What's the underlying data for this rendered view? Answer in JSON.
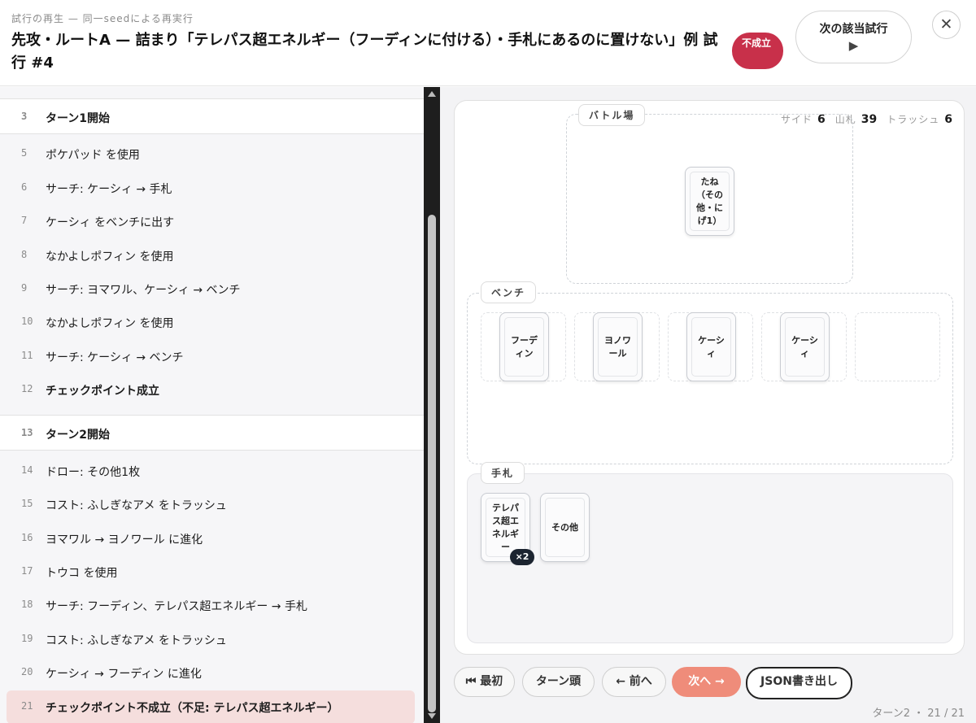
{
  "header": {
    "subtitle": "試行の再生 — 同一seedによる再実行",
    "title": "先攻・ルートA — 詰まり「テレパス超エネルギー（フーディンに付ける）・手札にあるのに置けない」例 試行 #4",
    "badge": "不成立",
    "next_trial_label": "次の該当試行",
    "next_trial_icon": "play-icon",
    "close_icon": "close-icon"
  },
  "log": [
    {
      "num": "3",
      "text": "ターン1開始",
      "kind": "turn"
    },
    {
      "num": "5",
      "text": "ポケパッド を使用",
      "kind": "normal"
    },
    {
      "num": "6",
      "text": "サーチ: ケーシィ → 手札",
      "kind": "normal"
    },
    {
      "num": "7",
      "text": "ケーシィ をベンチに出す",
      "kind": "normal"
    },
    {
      "num": "8",
      "text": "なかよしポフィン を使用",
      "kind": "normal"
    },
    {
      "num": "9",
      "text": "サーチ: ヨマワル、ケーシィ → ベンチ",
      "kind": "normal"
    },
    {
      "num": "10",
      "text": "なかよしポフィン を使用",
      "kind": "normal"
    },
    {
      "num": "11",
      "text": "サーチ: ケーシィ → ベンチ",
      "kind": "normal"
    },
    {
      "num": "12",
      "text": "チェックポイント成立",
      "kind": "bold"
    },
    {
      "num": "13",
      "text": "ターン2開始",
      "kind": "turn"
    },
    {
      "num": "14",
      "text": "ドロー: その他1枚",
      "kind": "normal"
    },
    {
      "num": "15",
      "text": "コスト: ふしぎなアメ をトラッシュ",
      "kind": "normal"
    },
    {
      "num": "16",
      "text": "ヨマワル → ヨノワール に進化",
      "kind": "normal"
    },
    {
      "num": "17",
      "text": "トウコ を使用",
      "kind": "normal"
    },
    {
      "num": "18",
      "text": "サーチ: フーディン、テレパス超エネルギー → 手札",
      "kind": "normal"
    },
    {
      "num": "19",
      "text": "コスト: ふしぎなアメ をトラッシュ",
      "kind": "normal"
    },
    {
      "num": "20",
      "text": "ケーシィ → フーディン に進化",
      "kind": "normal"
    },
    {
      "num": "21",
      "text": "チェックポイント不成立（不足: テレパス超エネルギー）",
      "kind": "current"
    }
  ],
  "board": {
    "stats": {
      "side_label": "サイド",
      "side": "6",
      "deck_label": "山札",
      "deck": "39",
      "trash_label": "トラッシュ",
      "trash": "6"
    },
    "battle_label": "バトル場",
    "battle_card": "たね（その他・にげ1）",
    "bench_label": "ベンチ",
    "bench": [
      "フーディン",
      "ヨノワール",
      "ケーシィ",
      "ケーシィ",
      ""
    ],
    "hand_label": "手札",
    "hand": [
      {
        "name": "テレパス超エネルギー",
        "count": "×2"
      },
      {
        "name": "その他",
        "count": ""
      }
    ]
  },
  "controls": {
    "first": "⏮ 最初",
    "turn_head": "ターン頭",
    "prev": "← 前へ",
    "next": "次へ →",
    "export": "JSON書き出し"
  },
  "progress": {
    "turn": "ターン2",
    "current": "21",
    "total": "21"
  },
  "colors": {
    "fail_badge": "#c8304a",
    "primary": "#ef8c7a",
    "current_row": "#f5dedd"
  }
}
